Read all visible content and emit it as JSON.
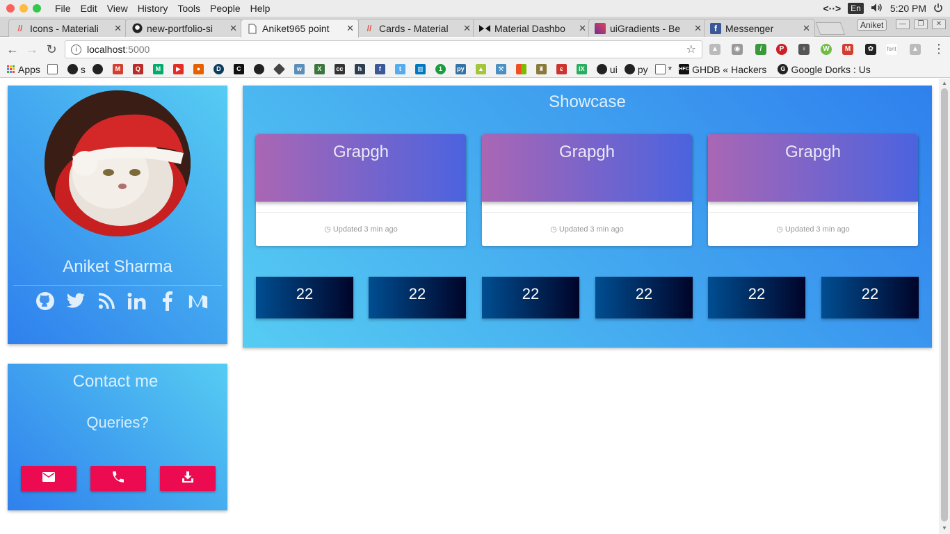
{
  "menubar": {
    "app": "File",
    "items": [
      "File",
      "Edit",
      "View",
      "History",
      "Tools",
      "People",
      "Help"
    ],
    "input_lang": "En",
    "time": "5:20 PM"
  },
  "tabs": [
    {
      "title": "Icons - Materiali",
      "icon": "material-icon",
      "color": "#e2574c"
    },
    {
      "title": "new-portfolio-si",
      "icon": "github-icon",
      "color": "#222222"
    },
    {
      "title": "Aniket965 point",
      "icon": "page-icon",
      "color": "#666666"
    },
    {
      "title": "Cards - Material",
      "icon": "material-icon",
      "color": "#e2574c"
    },
    {
      "title": "Material Dashbo",
      "icon": "bowtie-icon",
      "color": "#111111"
    },
    {
      "title": "uiGradients - Be",
      "icon": "gradient-icon",
      "color": "#8e44ad"
    },
    {
      "title": "Messenger",
      "icon": "facebook-icon",
      "color": "#3b5998"
    }
  ],
  "profile_name": "Aniket",
  "toolbar": {
    "url_host": "localhost",
    "url_port": ":5000"
  },
  "bookmarks": {
    "apps_label": "Apps",
    "items": [
      {
        "label": "s",
        "icon": "github-icon",
        "color": "#222"
      },
      {
        "label": "ui",
        "icon": "github-icon",
        "color": "#222"
      },
      {
        "label": "py",
        "icon": "github-icon",
        "color": "#222"
      },
      {
        "label": "*",
        "icon": "page-icon",
        "color": "#666"
      },
      {
        "label": "GHDB « Hackers",
        "icon": "hfc-icon",
        "color": "#111"
      },
      {
        "label": "Google Dorks : Us",
        "icon": "dorks-icon",
        "color": "#222"
      }
    ]
  },
  "profile_card": {
    "name": "Aniket Sharma",
    "socials": [
      "github-icon",
      "twitter-icon",
      "rss-icon",
      "linkedin-icon",
      "facebook-icon",
      "medium-icon"
    ]
  },
  "contact_card": {
    "title": "Contact me",
    "subtitle": "Queries?",
    "buttons": [
      "email-icon",
      "phone-icon",
      "download-icon"
    ]
  },
  "showcase": {
    "title": "Showcase",
    "cards": [
      {
        "title": "Grapgh",
        "updated": "Updated 3 min ago"
      },
      {
        "title": "Grapgh",
        "updated": "Updated 3 min ago"
      },
      {
        "title": "Grapgh",
        "updated": "Updated 3 min ago"
      }
    ],
    "stats": [
      "22",
      "22",
      "22",
      "22",
      "22",
      "22"
    ]
  },
  "colors": {
    "blue_gradient": [
      "#2f80ed",
      "#56ccf2"
    ],
    "purple_gradient": [
      "#aa66b4",
      "#4b63df"
    ],
    "navy_gradient": [
      "#004e92",
      "#000428"
    ],
    "accent_pink": "#ec0a50"
  }
}
